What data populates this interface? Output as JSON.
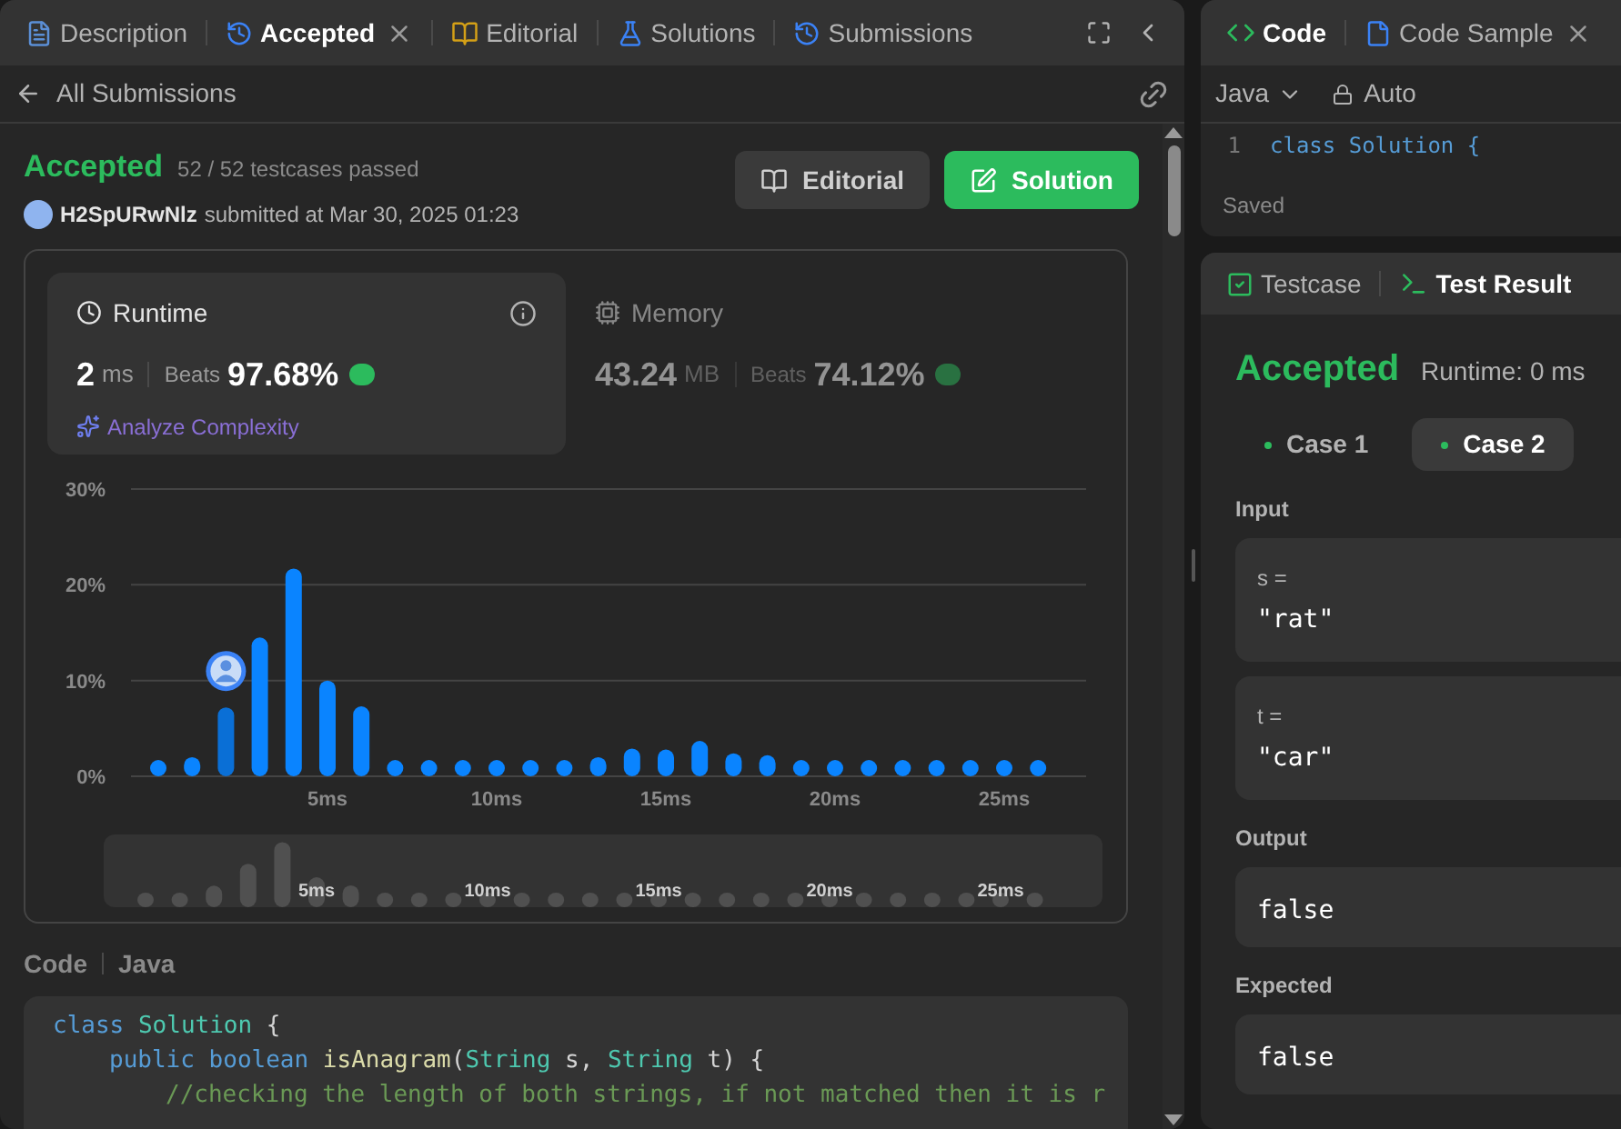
{
  "left_panel": {
    "tabs": [
      {
        "label": "Description",
        "selected": false,
        "closable": false
      },
      {
        "label": "Accepted",
        "selected": true,
        "closable": true
      },
      {
        "label": "Editorial",
        "selected": false,
        "closable": false
      },
      {
        "label": "Solutions",
        "selected": false,
        "closable": false
      },
      {
        "label": "Submissions",
        "selected": false,
        "closable": false
      }
    ],
    "back_link": "All Submissions",
    "result": {
      "status": "Accepted",
      "testcases": "52 / 52 testcases passed",
      "user": "H2SpURwNlz",
      "submitted": "submitted at Mar 30, 2025 01:23"
    },
    "buttons": [
      {
        "label": "Editorial",
        "kind": "secondary"
      },
      {
        "label": "Solution",
        "kind": "primary"
      }
    ],
    "stats": [
      {
        "kind": "runtime",
        "label": "Runtime",
        "value": "2",
        "unit": "ms",
        "beats_label": "Beats",
        "beats": "97.68%",
        "selected": true,
        "action": "Analyze Complexity"
      },
      {
        "kind": "memory",
        "label": "Memory",
        "value": "43.24",
        "unit": "MB",
        "beats_label": "Beats",
        "beats": "74.12%",
        "selected": false
      }
    ],
    "chart_data": {
      "type": "bar",
      "categories": [
        null,
        null,
        null,
        null,
        null,
        "5ms",
        null,
        null,
        null,
        null,
        "10ms",
        null,
        null,
        null,
        null,
        "15ms",
        null,
        null,
        null,
        null,
        "20ms",
        null,
        null,
        null,
        null,
        "25ms",
        null
      ],
      "values": [
        1.7,
        2.0,
        7.2,
        14.5,
        21.7,
        10.0,
        7.3,
        1.7,
        1.7,
        1.7,
        1.7,
        1.7,
        1.7,
        2.0,
        2.9,
        2.8,
        3.7,
        2.4,
        2.2,
        1.7,
        1.7,
        1.7,
        1.7,
        1.7,
        1.7,
        1.7,
        1.7
      ],
      "ylim": [
        0,
        30
      ],
      "yticks": [
        {
          "value": 0,
          "label": "0%"
        },
        {
          "value": 10,
          "label": "10%"
        },
        {
          "value": 20,
          "label": "20%"
        },
        {
          "value": 30,
          "label": "30%"
        }
      ],
      "orientation": "vertical"
    },
    "overview_labels": [
      "5ms",
      "10ms",
      "15ms",
      "20ms",
      "25ms"
    ],
    "code_section": {
      "title": "Code",
      "language": "Java",
      "lines": [
        {
          "tokens": [
            {
              "kind": "keyword",
              "text": "class"
            },
            {
              "kind": "type",
              "text": " Solution"
            },
            {
              "kind": "plain",
              "text": " {"
            }
          ],
          "children": [
            {
              "tokens": [
                {
                  "kind": "keyword",
                  "text": "public"
                },
                {
                  "kind": "keyword",
                  "text": " boolean"
                },
                {
                  "kind": "func",
                  "text": " isAnagram"
                },
                {
                  "kind": "plain",
                  "text": "("
                },
                {
                  "kind": "type",
                  "text": "String"
                },
                {
                  "kind": "plain",
                  "text": " s, "
                },
                {
                  "kind": "type",
                  "text": "String"
                },
                {
                  "kind": "plain",
                  "text": " t) {"
                }
              ],
              "children": [
                {
                  "tokens": [
                    {
                      "kind": "comment",
                      "text": "//checking the length of both strings, if not matched then it is r"
                    }
                  ]
                }
              ]
            }
          ]
        }
      ]
    }
  },
  "editor_panel": {
    "tabs": [
      {
        "label": "Code",
        "selected": true,
        "closable": false
      },
      {
        "label": "Code Sample",
        "selected": false,
        "closable": true
      }
    ],
    "language": "Java",
    "mode": "Auto",
    "line_number": "1",
    "line_text": "class Solution {",
    "status": "Saved"
  },
  "result_panel": {
    "tabs": [
      {
        "label": "Testcase",
        "selected": false
      },
      {
        "label": "Test Result",
        "selected": true
      }
    ],
    "status": "Accepted",
    "runtime": "Runtime: 0 ms",
    "cases": [
      {
        "label": "Case 1",
        "selected": false
      },
      {
        "label": "Case 2",
        "selected": true
      }
    ],
    "sections": [
      {
        "title": "Input",
        "fields": [
          {
            "name": "s =",
            "value": "\"rat\""
          },
          {
            "name": "t =",
            "value": "\"car\""
          }
        ]
      },
      {
        "title": "Output",
        "fields": [
          {
            "value": "false"
          }
        ]
      },
      {
        "title": "Expected",
        "fields": [
          {
            "value": "false"
          }
        ]
      }
    ]
  }
}
